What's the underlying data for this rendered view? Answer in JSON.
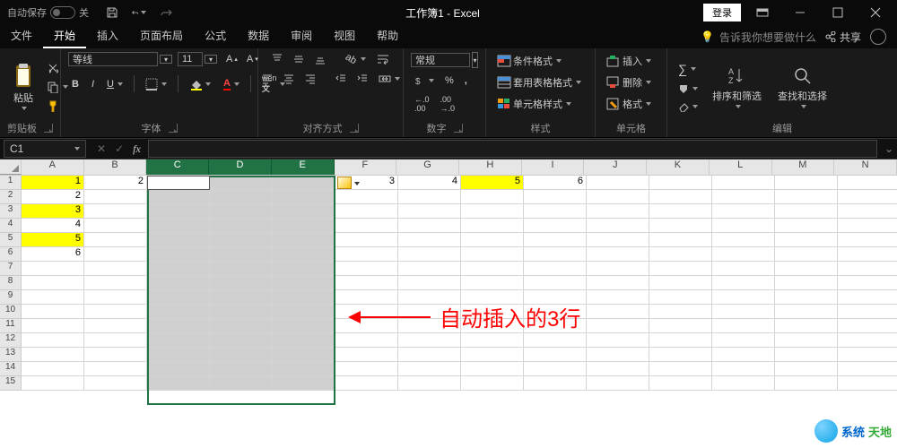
{
  "titlebar": {
    "autosave_label": "自动保存",
    "autosave_state": "关",
    "title": "工作簿1 - Excel",
    "login": "登录"
  },
  "tabs": {
    "items": [
      "文件",
      "开始",
      "插入",
      "页面布局",
      "公式",
      "数据",
      "审阅",
      "视图",
      "帮助"
    ],
    "active": 1,
    "tellme_placeholder": "告诉我你想要做什么",
    "share": "共享"
  },
  "ribbon": {
    "clipboard": {
      "label": "剪贴板",
      "paste": "粘贴"
    },
    "font": {
      "label": "字体",
      "name": "等线",
      "size": "11"
    },
    "align": {
      "label": "对齐方式"
    },
    "number": {
      "label": "数字",
      "format": "常规"
    },
    "styles": {
      "label": "样式",
      "cond": "条件格式",
      "table": "套用表格格式",
      "cell": "单元格样式"
    },
    "cells": {
      "label": "单元格",
      "insert": "插入",
      "delete": "删除",
      "format": "格式"
    },
    "editing": {
      "label": "编辑",
      "sort": "排序和筛选",
      "find": "查找和选择"
    }
  },
  "formula_bar": {
    "name": "C1"
  },
  "columns": [
    "A",
    "B",
    "C",
    "D",
    "E",
    "F",
    "G",
    "H",
    "I",
    "J",
    "K",
    "L",
    "M",
    "N"
  ],
  "selected_cols": [
    "C",
    "D",
    "E"
  ],
  "rows": [
    1,
    2,
    3,
    4,
    5,
    6,
    7,
    8,
    9,
    10,
    11,
    12,
    13,
    14,
    15
  ],
  "data": {
    "A1": "1",
    "A2": "2",
    "A3": "3",
    "A4": "4",
    "A5": "5",
    "A6": "6",
    "B1": "2",
    "F1": "3",
    "G1": "4",
    "H1": "5",
    "I1": "6"
  },
  "yellow_cells": [
    "A1",
    "A3",
    "A5",
    "H1"
  ],
  "annotation": {
    "text": "自动插入的3行"
  },
  "watermark": {
    "t1": "系统",
    "t2": "天地"
  }
}
